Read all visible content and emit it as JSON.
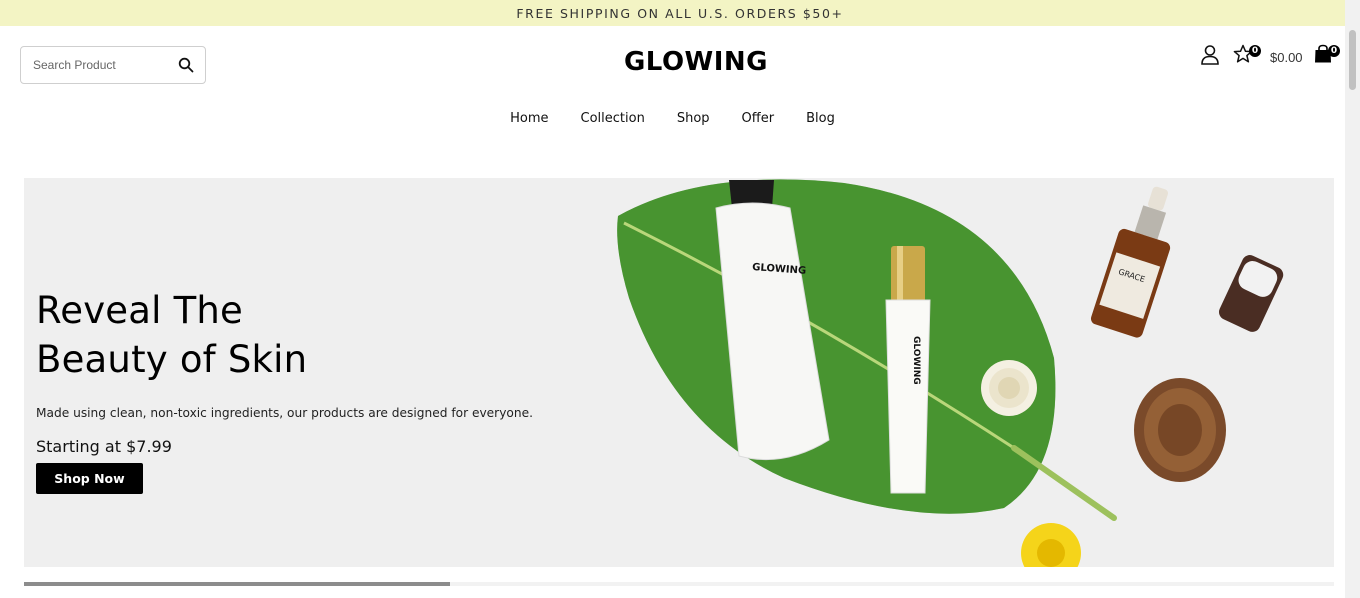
{
  "announcement": "FREE SHIPPING ON ALL U.S. ORDERS $50+",
  "search": {
    "placeholder": "Search Product",
    "icon": "search-icon"
  },
  "logo": "GLOWING",
  "header": {
    "user_icon": "user-icon",
    "wishlist_icon": "star-icon",
    "wishlist_count": "0",
    "cart_total": "$0.00",
    "cart_icon": "shopping-bag-icon",
    "cart_count": "0"
  },
  "nav": {
    "items": [
      {
        "label": "Home"
      },
      {
        "label": "Collection"
      },
      {
        "label": "Shop"
      },
      {
        "label": "Offer"
      },
      {
        "label": "Blog"
      }
    ]
  },
  "hero": {
    "title_line1": "Reveal The",
    "title_line2": "Beauty of Skin",
    "subtitle": "Made using clean, non-toxic ingredients, our products are designed for everyone.",
    "price_text": "Starting at $7.99",
    "cta_label": "Shop Now",
    "product_brand_tube": "GLOWING",
    "product_brand_small": "GLOWING",
    "bottle_label": "GRACE"
  },
  "slider": {
    "progress": 0.325
  },
  "colors": {
    "announcement_bg": "#f3f4c4",
    "hero_bg": "#efefef",
    "button_bg": "#000000",
    "leaf": "#3f8a2c"
  }
}
